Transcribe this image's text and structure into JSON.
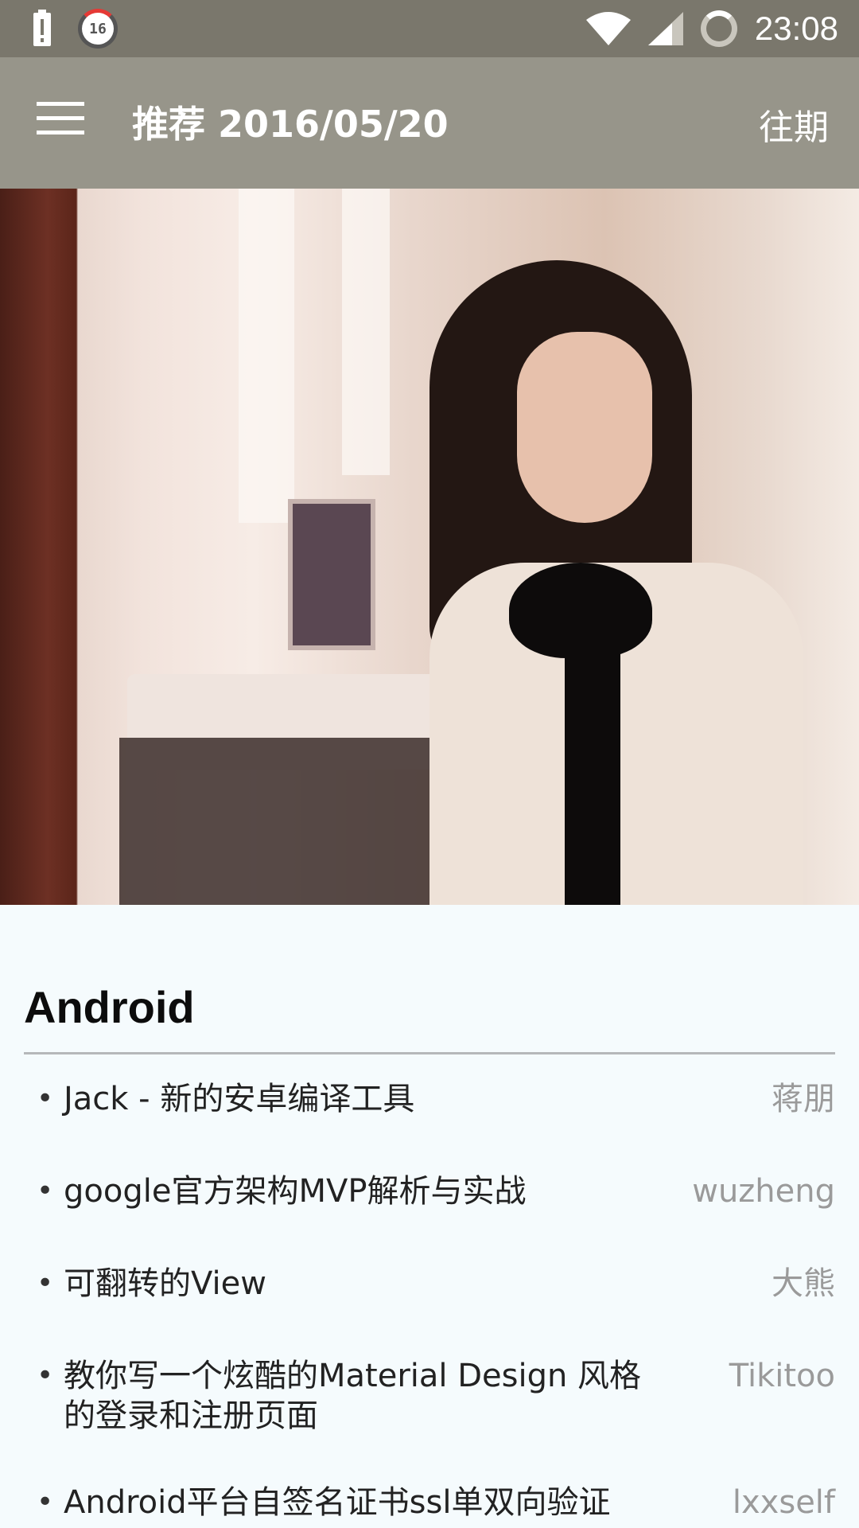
{
  "status_bar": {
    "alert_icon": "battery-alert-icon",
    "badge_number": "16",
    "wifi_icon": "wifi-icon",
    "signal_icon": "cell-signal-icon",
    "sync_icon": "sync-progress-icon",
    "time": "23:08"
  },
  "toolbar": {
    "menu_icon": "hamburger-menu-icon",
    "title": "推荐 2016/05/20",
    "action_label": "往期",
    "color": "#97958a"
  },
  "hero": {
    "type": "photo"
  },
  "section": {
    "title": "Android"
  },
  "articles": [
    {
      "title": "Jack - 新的安卓编译工具",
      "author": "蒋朋"
    },
    {
      "title": "google官方架构MVP解析与实战",
      "author": "wuzheng"
    },
    {
      "title": "可翻转的View",
      "author": "大熊"
    },
    {
      "title": "教你写一个炫酷的Material Design 风格的登录和注册页面",
      "author": "Tikitoo"
    },
    {
      "title": "Android平台自签名证书ssl单双向验证",
      "author": "lxxself"
    }
  ]
}
